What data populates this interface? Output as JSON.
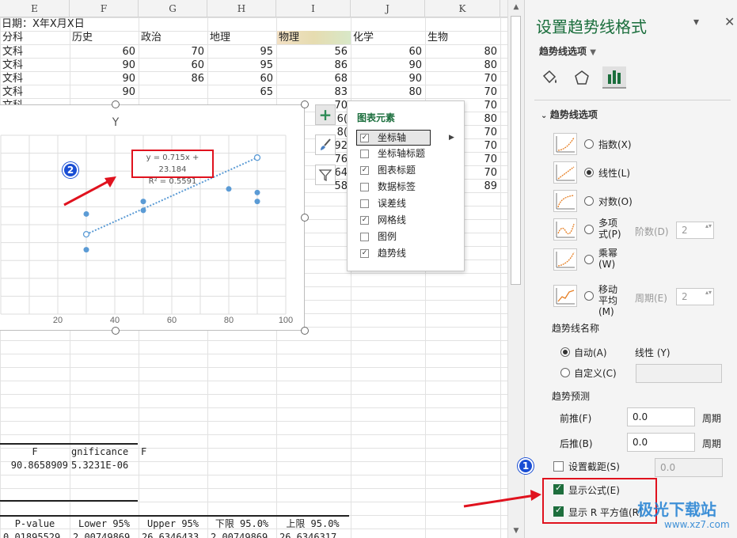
{
  "sheet": {
    "columns": [
      "E",
      "F",
      "G",
      "H",
      "I",
      "J",
      "K"
    ],
    "date_label": "日期：X年X月X日",
    "headers": [
      "分科",
      "历史",
      "政治",
      "地理",
      "物理",
      "化学",
      "生物"
    ],
    "rows": [
      [
        "文科",
        "60",
        "70",
        "95",
        "56",
        "60",
        "80"
      ],
      [
        "文科",
        "90",
        "60",
        "95",
        "86",
        "90",
        "80"
      ],
      [
        "文科",
        "90",
        "86",
        "60",
        "68",
        "90",
        "70"
      ],
      [
        "文科",
        "90",
        "",
        "65",
        "83",
        "80",
        "70"
      ],
      [
        "文科",
        "",
        "",
        "",
        "70",
        "",
        "70"
      ]
    ],
    "hidden_I": [
      "6(",
      "8(",
      "92",
      "76",
      "64",
      "58"
    ],
    "hidden_K": [
      "80",
      "70",
      "70",
      "70",
      "70",
      "89"
    ],
    "anova": {
      "header_F": "F",
      "header_sig": "gnificance",
      "header_extra": "F",
      "f_value": "90.8658909",
      "sig_value": "5.3231E-06"
    },
    "coef_headers": [
      "P-value",
      "Lower 95%",
      "Upper 95%",
      "下限 95.0%",
      "上限 95.0%"
    ],
    "coef_row_partial": [
      "0.01895529",
      "2.00749869",
      "26.6346433",
      "2.00749869",
      "26.6346317"
    ]
  },
  "chart": {
    "title": "Y",
    "equation": "y = 0.715x + 23.184",
    "r2": "R² = 0.5591",
    "badge2": "2"
  },
  "chart_data": {
    "type": "scatter",
    "title": "Y",
    "xlabel": "",
    "ylabel": "",
    "xlim": [
      0,
      100
    ],
    "ylim": [
      0,
      100
    ],
    "x_ticks": [
      "20",
      "40",
      "60",
      "80",
      "100"
    ],
    "points": [
      {
        "x": 30,
        "y": 36
      },
      {
        "x": 30,
        "y": 56
      },
      {
        "x": 50,
        "y": 63
      },
      {
        "x": 50,
        "y": 58
      },
      {
        "x": 80,
        "y": 70
      },
      {
        "x": 90,
        "y": 68
      },
      {
        "x": 90,
        "y": 63
      }
    ],
    "trendline": {
      "type": "linear",
      "slope": 0.715,
      "intercept": 23.184,
      "from": 30,
      "to": 90
    },
    "grid": true,
    "colors": {
      "points": "#5b9bd5"
    }
  },
  "flyout": {
    "title": "图表元素",
    "items": [
      {
        "label": "坐标轴",
        "checked": true,
        "selected": true
      },
      {
        "label": "坐标轴标题",
        "checked": false
      },
      {
        "label": "图表标题",
        "checked": true
      },
      {
        "label": "数据标签",
        "checked": false
      },
      {
        "label": "误差线",
        "checked": false
      },
      {
        "label": "网格线",
        "checked": true
      },
      {
        "label": "图例",
        "checked": false
      },
      {
        "label": "趋势线",
        "checked": true
      }
    ]
  },
  "pane": {
    "title": "设置趋势线格式",
    "options_label": "趋势线选项",
    "section": "趋势线选项",
    "types": [
      {
        "label": "指数(X)",
        "on": false
      },
      {
        "label": "线性(L)",
        "on": true
      },
      {
        "label": "对数(O)",
        "on": false
      },
      {
        "label": "多项式(P)",
        "on": false
      },
      {
        "label": "乘幂(W)",
        "on": false
      },
      {
        "label": "移动平均(M)",
        "on": false
      }
    ],
    "order_label": "阶数(D)",
    "order_value": "2",
    "period_label": "周期(E)",
    "period_value": "2",
    "name_header": "趋势线名称",
    "auto_label": "自动(A)",
    "auto_value": "线性 (Y)",
    "custom_label": "自定义(C)",
    "forecast_header": "趋势预测",
    "forward_label": "前推(F)",
    "forward_value": "0.0",
    "backward_label": "后推(B)",
    "backward_value": "0.0",
    "period_unit": "周期",
    "intercept_label": "设置截距(S)",
    "intercept_value": "0.0",
    "show_eq_label": "显示公式(E)",
    "show_r2_label": "显示 R 平方值(R)",
    "badge1": "1",
    "watermark": "极光下载站",
    "watermark_url": "www.xz7.com"
  }
}
